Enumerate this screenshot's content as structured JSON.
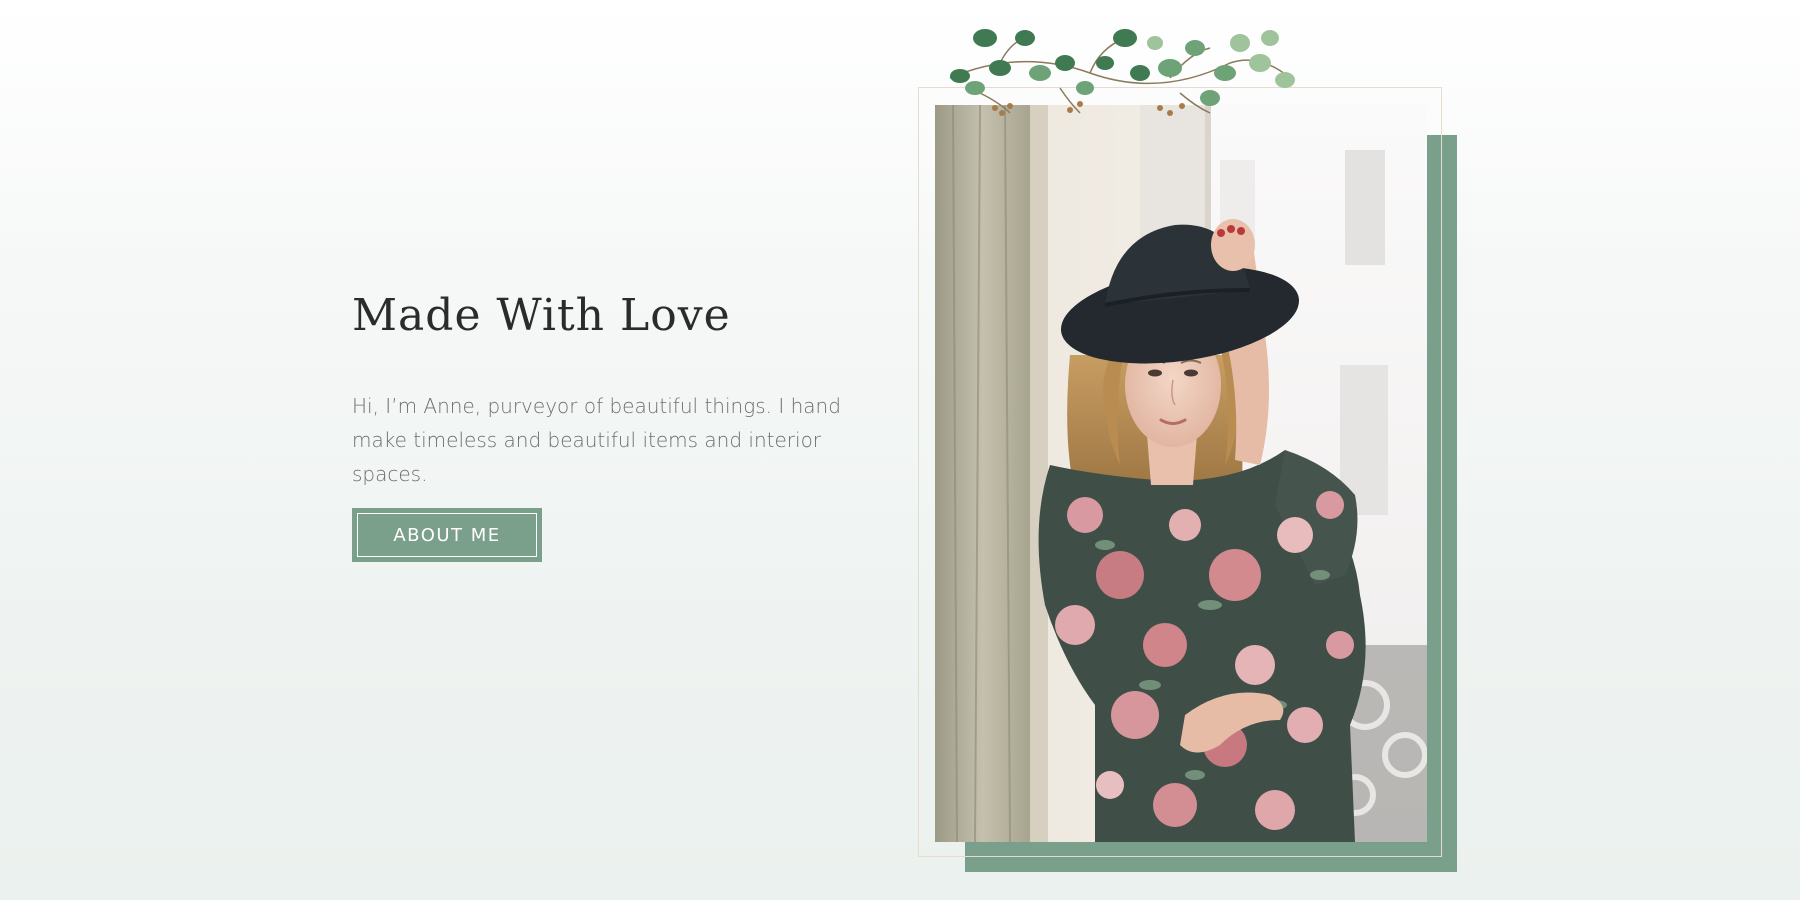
{
  "hero": {
    "title": "Made With Love",
    "description": "Hi, I’m Anne, purveyor of beautiful things. I hand make timeless and beautiful items and interior spaces.",
    "button_label": "ABOUT ME"
  },
  "colors": {
    "accent": "#7a9f8b",
    "title": "#2b2b2b",
    "body_text": "#6d6d6d",
    "frame_line": "#e5dccd"
  },
  "images": {
    "portrait": "woman-in-hat-floral-dress-photo",
    "garland": "eucalyptus-garland-decoration"
  }
}
